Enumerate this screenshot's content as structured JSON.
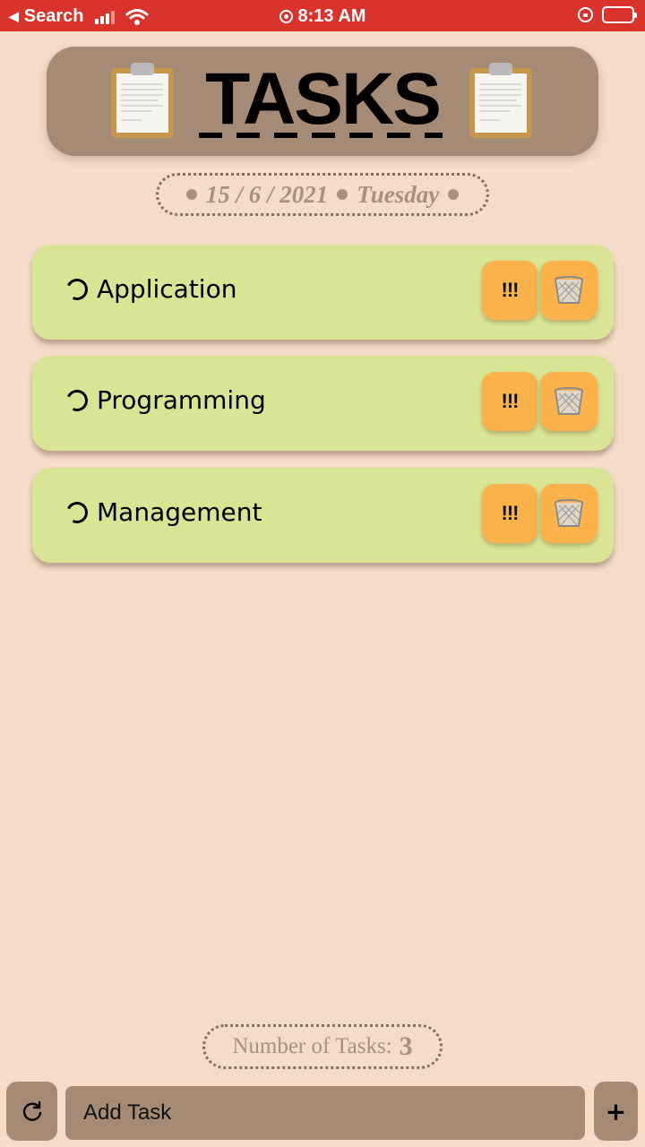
{
  "status_bar": {
    "back_label": "Search",
    "time": "8:13 AM"
  },
  "header": {
    "title": "TASKS"
  },
  "date": {
    "date_text": "15 / 6 / 2021",
    "weekday": "Tuesday"
  },
  "tasks": [
    {
      "label": "Application",
      "priority_label": "!!!",
      "icon": "trash-basket-icon"
    },
    {
      "label": "Programming",
      "priority_label": "!!!",
      "icon": "trash-basket-icon"
    },
    {
      "label": "Management",
      "priority_label": "!!!",
      "icon": "trash-basket-icon"
    }
  ],
  "counter": {
    "label": "Number of Tasks:",
    "value": "3"
  },
  "bottom_bar": {
    "input_placeholder": "Add Task",
    "add_label": "+"
  },
  "colors": {
    "background": "#f4dcc8",
    "status_bar": "#d9342b",
    "header_card": "#a58b76",
    "task_card": "#d7e595",
    "action_button": "#fcb24a"
  }
}
